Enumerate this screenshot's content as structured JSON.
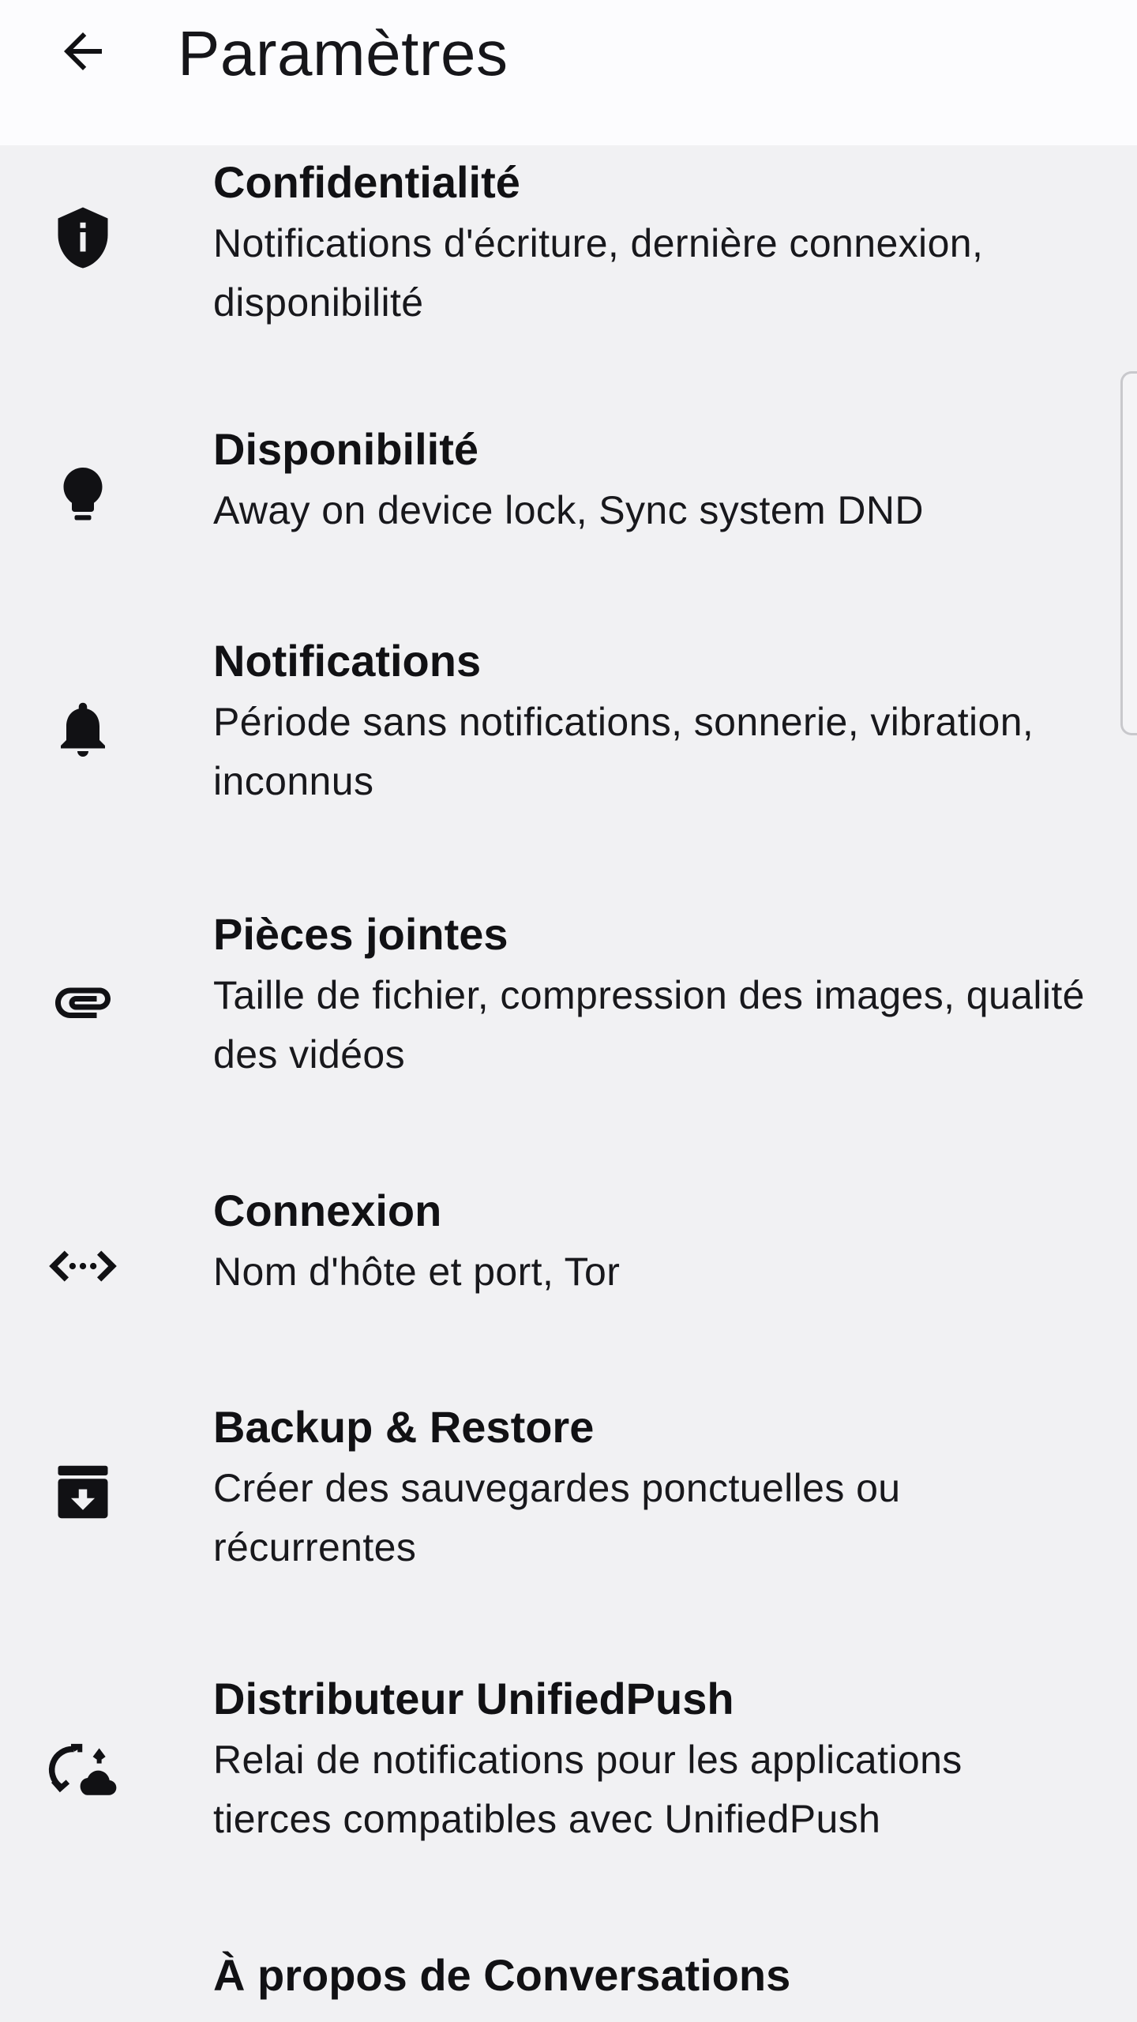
{
  "header": {
    "title": "Paramètres",
    "back_icon": "arrow-left-icon"
  },
  "settings": [
    {
      "title": "Confidentialité",
      "subtitle": "Notifications d'écriture, dernière connexion, disponibilité",
      "icon": "shield-info-icon"
    },
    {
      "title": "Disponibilité",
      "subtitle": "Away on device lock, Sync system DND",
      "icon": "lightbulb-icon"
    },
    {
      "title": "Notifications",
      "subtitle": "Période sans notifications, sonnerie, vibration, inconnus",
      "icon": "bell-icon"
    },
    {
      "title": "Pièces jointes",
      "subtitle": "Taille de fichier, compression des images, qualité des vidéos",
      "icon": "paperclip-icon"
    },
    {
      "title": "Connexion",
      "subtitle": "Nom d'hôte et port, Tor",
      "icon": "connection-arrows-icon"
    },
    {
      "title": "Backup & Restore",
      "subtitle": "Créer des sauvegardes ponctuelles ou récurrentes",
      "icon": "archive-download-icon"
    },
    {
      "title": "Distributeur UnifiedPush",
      "subtitle": "Relai de notifications pour les applications tierces compatibles avec UnifiedPush",
      "icon": "cloud-sync-icon"
    },
    {
      "title": "À propos de Conversations",
      "subtitle": "",
      "icon": ""
    }
  ],
  "colors": {
    "background": "#f1f1f3",
    "appbar": "#fcfcfe",
    "text": "#111114"
  }
}
